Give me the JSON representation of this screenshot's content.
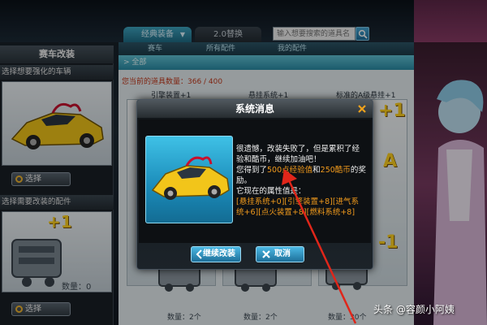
{
  "topbar": {
    "tab_classic": "经典装备",
    "tab_20": "2.0替换",
    "search_placeholder": "输入想要搜索的道具名"
  },
  "left_panel": {
    "header": "赛车改装",
    "section1_title": "选择想要强化的车辆",
    "select_label_1": "选择",
    "section2_title": "选择需要改装的配件",
    "plus_one": "+1",
    "quantity": "数量：0",
    "select_label_2": "选择"
  },
  "center_panel": {
    "tabs": [
      "赛车",
      "所有配件",
      "我的配件"
    ],
    "breadcrumb": "全部",
    "count_line": "您当前的道具数量：366 / 400",
    "item_titles": [
      "引擎装置+1",
      "悬挂系统+1",
      "标准的A级悬挂+1"
    ],
    "qty_small": [
      "数量：2个",
      "数量：2个",
      "数量：30个"
    ]
  },
  "right_overlay": {
    "plus_one": "+1",
    "letter": "A",
    "minus_one": "-1"
  },
  "dialog": {
    "title": "系统消息",
    "line1": "很遗憾，改装失败了，但是累积了经验和酷币，继续加油吧！",
    "line2_prefix": "您得到了",
    "line2_exp": "500点经验值",
    "line2_mid": "和",
    "line2_coin": "250酷币",
    "line2_suffix": "的奖励。",
    "attr_title": "它现在的属性值是：",
    "attr_values": "[悬挂系统+0][引擎装置+8][进气系统+6][点火装置+8][燃料系统+8]",
    "continue_label": "继续改装",
    "cancel_label": "取消"
  },
  "watermark": "头条 @容颜小阿姨",
  "colors": {
    "accent_blue": "#2b8da6",
    "highlight_orange": "#f09a1c",
    "warning_red": "#c43a1c",
    "gold": "#ffd21f",
    "arrow_red": "#e0261a"
  }
}
